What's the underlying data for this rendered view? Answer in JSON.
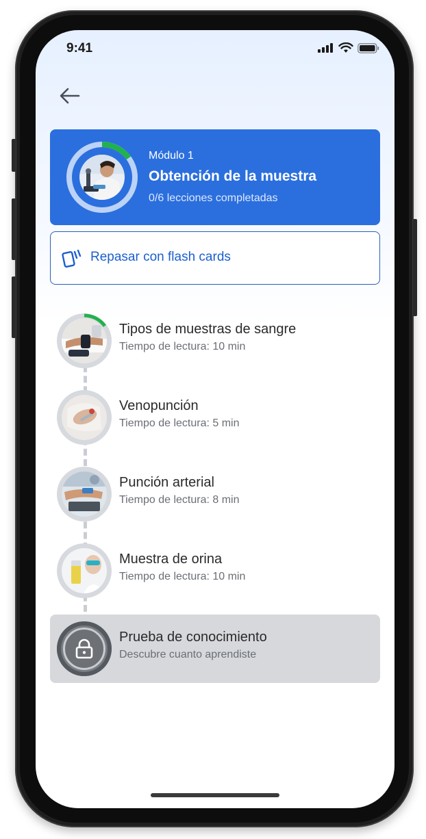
{
  "status_bar": {
    "time": "9:41"
  },
  "module": {
    "subtitle": "Módulo 1",
    "title": "Obtención de la muestra",
    "progress_text": "0/6 lecciones completadas",
    "progress_fraction": 0.15
  },
  "flash_cards": {
    "label": "Repasar con flash cards",
    "icon": "flash-cards-icon"
  },
  "lessons": [
    {
      "title": "Tipos de muestras de sangre",
      "subtitle": "Tiempo de lectura: 10 min",
      "progress_fraction": 0.15
    },
    {
      "title": "Venopunción",
      "subtitle": "Tiempo de lectura: 5 min",
      "progress_fraction": 0
    },
    {
      "title": "Punción arterial",
      "subtitle": "Tiempo de lectura: 8 min",
      "progress_fraction": 0
    },
    {
      "title": "Muestra de orina",
      "subtitle": "Tiempo de lectura: 10 min",
      "progress_fraction": 0
    }
  ],
  "quiz": {
    "title": "Prueba de conocimiento",
    "subtitle": "Descubre cuanto aprendiste",
    "locked": true,
    "icon": "lock-icon"
  },
  "colors": {
    "primary": "#2b6fde",
    "progress_green": "#22b14c",
    "ring_light": "#bcd3f7",
    "locked_bg": "#d6d8dc"
  }
}
